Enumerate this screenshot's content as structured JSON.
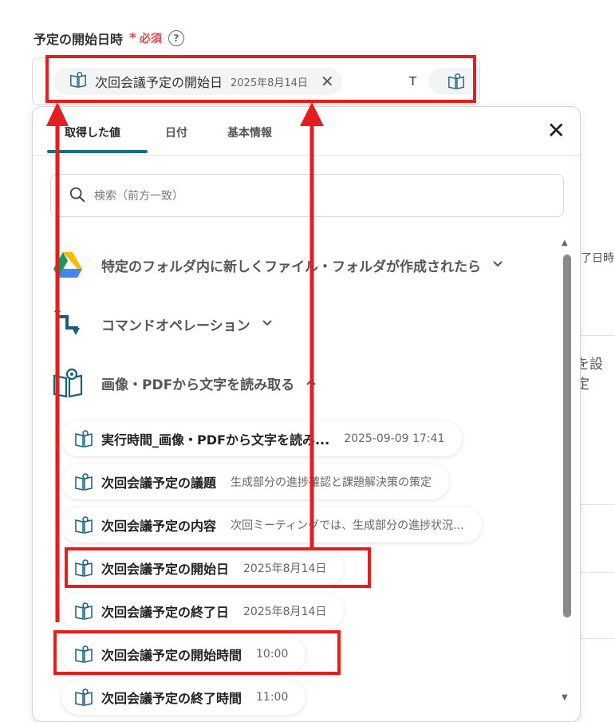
{
  "field": {
    "label": "予定の開始日時",
    "required_mark": "*",
    "required_text": "必須",
    "help_symbol": "?"
  },
  "token": {
    "label": "次回会議予定の開始日",
    "value": "2025年8月14日",
    "remove_symbol": "✕",
    "separator_text": "T"
  },
  "panel": {
    "tabs": [
      {
        "label": "取得した値"
      },
      {
        "label": "日付"
      },
      {
        "label": "基本情報"
      }
    ],
    "close_symbol": "✕",
    "search": {
      "placeholder": "検索（前方一致）"
    },
    "groups": [
      {
        "label": "特定のフォルダ内に新しくファイル・フォルダが作成されたら",
        "icon": "google-drive-icon"
      },
      {
        "label": "コマンドオペレーション",
        "icon": "command-operation-icon"
      },
      {
        "label": "画像・PDFから文字を読み取る",
        "icon": "ocr-book-icon"
      }
    ],
    "items": [
      {
        "label": "実行時間_画像・PDFから文字を読み...",
        "value": "2025-09-09 17:41"
      },
      {
        "label": "次回会議予定の議題",
        "value": "生成部分の進捗確認と課題解決策の策定"
      },
      {
        "label": "次回会議予定の内容",
        "value": "次回ミーティングでは、生成部分の進捗状況..."
      },
      {
        "label": "次回会議予定の開始日",
        "value": "2025年8月14日"
      },
      {
        "label": "次回会議予定の終了日",
        "value": "2025年8月14日"
      },
      {
        "label": "次回会議予定の開始時間",
        "value": "10:00"
      },
      {
        "label": "次回会議予定の終了時間",
        "value": "11:00"
      }
    ]
  },
  "background": {
    "frag1": "了日時",
    "frag2": "を設定"
  },
  "colors": {
    "accent": "#1a6f7a",
    "required": "#e8434f",
    "highlight": "#e21e1e"
  }
}
